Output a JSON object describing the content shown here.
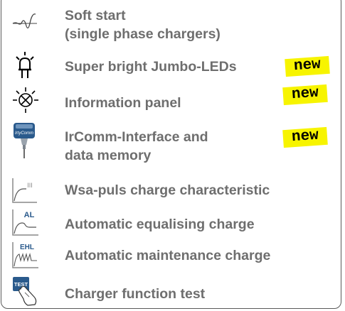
{
  "features": [
    {
      "icon": "soft-start-wave-icon",
      "lines": [
        "Soft start",
        "(single phase chargers)"
      ],
      "badge": ""
    },
    {
      "icon": "led-bulb-icon",
      "lines": [
        "Super bright Jumbo-LEDs"
      ],
      "badge": "new"
    },
    {
      "icon": "information-panel-icon",
      "lines": [
        "Information panel"
      ],
      "badge": "new"
    },
    {
      "icon": "ircomm-device-icon",
      "lines": [
        "IrComm-Interface and",
        "data memory"
      ],
      "badge": "new",
      "icon_text": "IrtyComm"
    },
    {
      "icon": "wsa-puls-curve-icon",
      "lines": [
        "Wsa-puls charge characteristic"
      ],
      "badge": "",
      "icon_text": "III"
    },
    {
      "icon": "equalising-charge-icon",
      "lines": [
        "Automatic equalising charge"
      ],
      "badge": "",
      "icon_text": "AL"
    },
    {
      "icon": "maintenance-charge-icon",
      "lines": [
        "Automatic maintenance charge"
      ],
      "badge": "",
      "icon_text": "EHL"
    },
    {
      "icon": "test-button-icon",
      "lines": [
        "Charger function test"
      ],
      "badge": "",
      "icon_text": "TEST"
    }
  ],
  "colors": {
    "text": "#6e6e6e",
    "badge": "#f7f400",
    "icon_blue": "#2a5a8c"
  }
}
